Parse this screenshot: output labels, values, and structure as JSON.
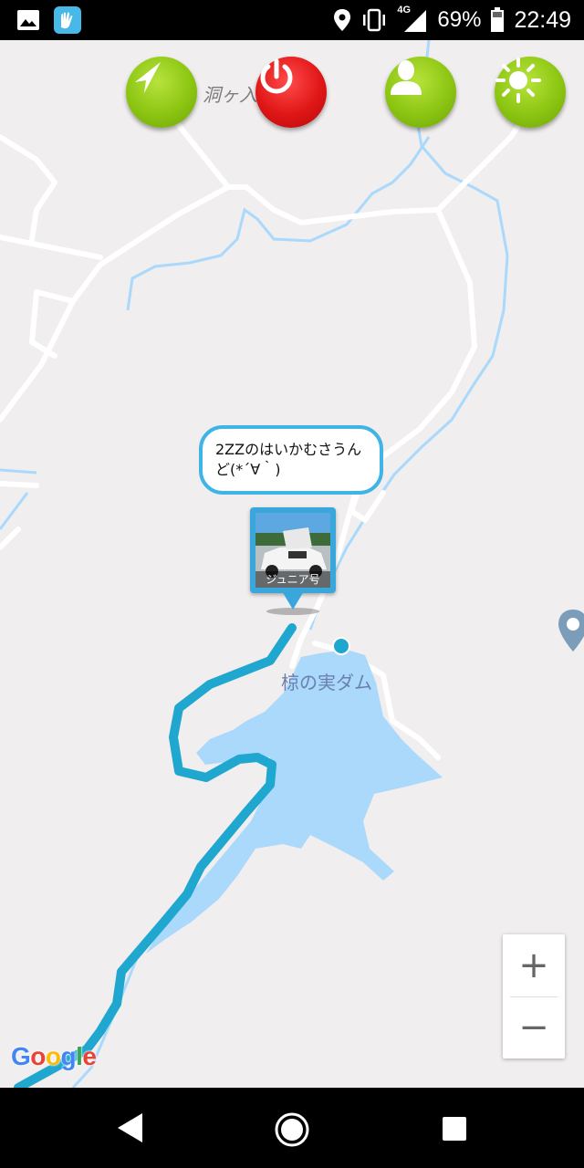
{
  "status_bar": {
    "network": "4G",
    "battery_percent": "69%",
    "time": "22:49",
    "icons": [
      "gallery-icon",
      "app-notification-icon",
      "location-icon",
      "vibrate-icon",
      "signal-icon",
      "battery-icon"
    ]
  },
  "map": {
    "place_top": "洞ヶ入",
    "dam_label": "椋の実ダム",
    "google_logo": "Google",
    "colors": {
      "water": "#aad9fb",
      "route": "#1fa7cf",
      "road": "#ffffff",
      "background": "#f0eeee"
    }
  },
  "toolbar": {
    "buttons": [
      {
        "name": "navigate",
        "icon": "navigation-arrow-icon",
        "color": "green"
      },
      {
        "name": "power",
        "icon": "power-icon",
        "color": "red"
      },
      {
        "name": "profile",
        "icon": "person-icon",
        "color": "green"
      },
      {
        "name": "brightness",
        "icon": "sun-icon",
        "color": "green"
      }
    ]
  },
  "marker": {
    "bubble_text": "2ZZのはいかむさうんど(*´∀｀)",
    "photo_caption": "ジュニア号"
  },
  "zoom": {
    "plus": "+",
    "minus": "−"
  },
  "nav_bar": {
    "buttons": [
      "back-icon",
      "home-icon",
      "recents-icon"
    ]
  }
}
